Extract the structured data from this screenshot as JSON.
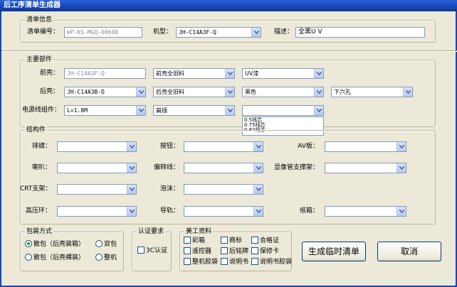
{
  "window": {
    "title": "后工序清单生成器"
  },
  "info": {
    "title": "清单信息",
    "order_label": "清单编号：",
    "order_value": "WP-KS-MGQ-00688",
    "model_label": "机型：",
    "model_value": "JH-C14A3F-Q",
    "desc_label": "描述：",
    "desc_value": "全黑U V"
  },
  "main_parts": {
    "title": "主要部件",
    "front_label": "前壳：",
    "front_value": "JH-C14A3F-Q",
    "front_material": "前壳全旧料",
    "front_finish": "UV漆",
    "back_label": "后壳：",
    "back_value": "JH-C14A3B-D",
    "back_material": "后壳全旧料",
    "back_color": "黑色",
    "back_hole": "下六孔",
    "power_label": "电源线组件：",
    "power_value": "L=1.8M",
    "power_plug": "扁插",
    "power_core": "",
    "core_options": [
      "0.5线芯",
      "0.75线芯",
      "0.82线芯"
    ]
  },
  "structure": {
    "title": "结构件",
    "left_labels": [
      "排键：",
      "喇叭：",
      "CRT支架：",
      "高压环："
    ],
    "mid_labels": [
      "按钮：",
      "偏转线：",
      "泡沫：",
      "导轨："
    ],
    "right_labels": [
      "AV板：",
      "显像管支撑架：",
      "",
      "纸箱："
    ]
  },
  "packaging": {
    "title": "包装方式",
    "opt1": "散包（后壳装箱）",
    "opt2": "散包（后壳裸装）",
    "opt3": "双包",
    "opt4": "整机"
  },
  "cert": {
    "title": "认证要求",
    "opt1": "3C认证"
  },
  "art": {
    "title": "美工资料",
    "items": [
      "彩箱",
      "商标",
      "合格证",
      "遥控器",
      "后铭牌",
      "保修卡",
      "整机胶袋",
      "说明书",
      "说明书胶袋"
    ]
  },
  "buttons": {
    "generate": "生成临时清单",
    "cancel": "取消"
  }
}
